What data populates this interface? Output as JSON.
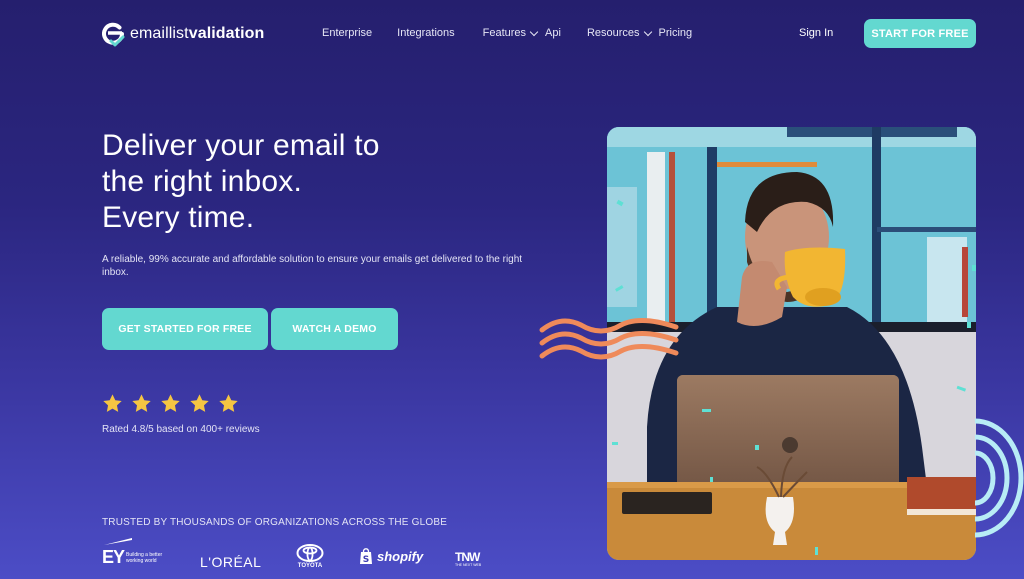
{
  "brand": {
    "name_light": "emaillist",
    "name_bold": "validation",
    "accent_color": "#63d8d0"
  },
  "nav": {
    "links": [
      {
        "label": "Enterprise",
        "has_dropdown": false
      },
      {
        "label": "Integrations",
        "has_dropdown": false
      },
      {
        "label": "Features",
        "has_dropdown": true
      },
      {
        "label": "Api",
        "has_dropdown": false
      },
      {
        "label": "Resources",
        "has_dropdown": true
      },
      {
        "label": "Pricing",
        "has_dropdown": false
      }
    ],
    "sign_in": "Sign In",
    "start_button": "START FOR FREE"
  },
  "hero": {
    "headline_lines": [
      "Deliver your email to",
      "the right inbox.",
      "Every time."
    ],
    "subtext": "A reliable, 99% accurate and affordable solution to ensure your emails get delivered to the right inbox.",
    "cta_primary": "GET STARTED FOR FREE",
    "cta_secondary": "WATCH A DEMO",
    "stars": 5,
    "star_color": "#f5c542",
    "rating_text": "Rated 4.8/5 based on 400+ reviews"
  },
  "trusted": {
    "heading": "TRUSTED BY THOUSANDS OF ORGANIZATIONS ACROSS THE GLOBE",
    "logos": [
      {
        "name": "EY",
        "tagline": "Building a better working world"
      },
      {
        "name": "L'ORÉAL"
      },
      {
        "name": "TOYOTA"
      },
      {
        "name": "shopify"
      },
      {
        "name": "TNW",
        "tagline": "THE NEXT WEB"
      }
    ]
  },
  "image": {
    "alt": "Man drinking from a yellow cup behind a laptop"
  }
}
